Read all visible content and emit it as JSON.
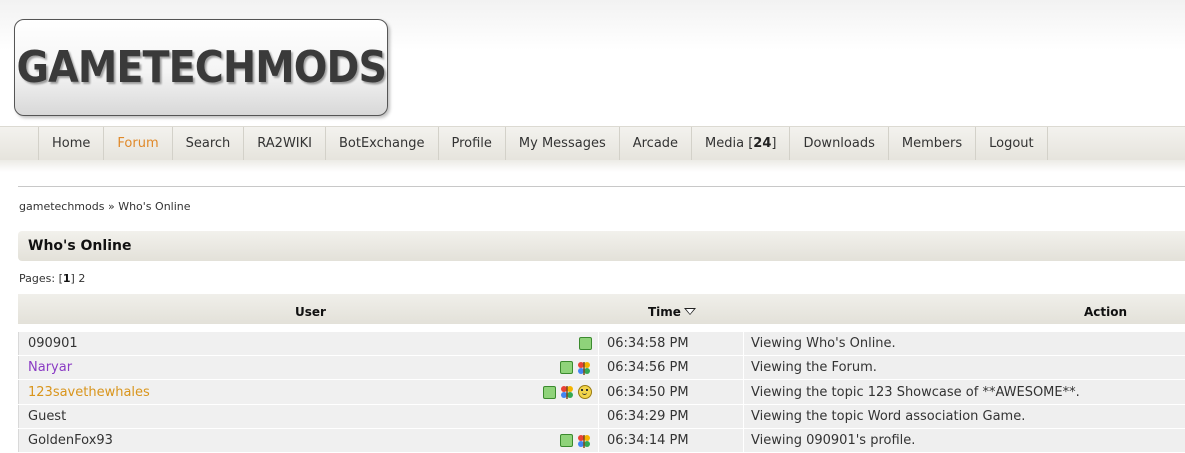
{
  "site": {
    "logo_text": "GAMETECHMODS"
  },
  "nav": {
    "items": [
      {
        "label": "Home"
      },
      {
        "label": "Forum"
      },
      {
        "label": "Search"
      },
      {
        "label": "RA2WIKI"
      },
      {
        "label": "BotExchange"
      },
      {
        "label": "Profile"
      },
      {
        "label": "My Messages"
      },
      {
        "label": "Arcade"
      },
      {
        "label": "Media [",
        "count": "24",
        "suffix": "]"
      },
      {
        "label": "Downloads"
      },
      {
        "label": "Members"
      },
      {
        "label": "Logout"
      }
    ],
    "active": "Forum",
    "active_color": "#e0892a"
  },
  "breadcrumb": {
    "home": "gametechmods",
    "separator": "»",
    "current": "Who's Online"
  },
  "page_title": "Who's Online",
  "pagination": {
    "label": "Pages:",
    "current": "1",
    "other": "2"
  },
  "table": {
    "headers": {
      "user": "User",
      "time": "Time",
      "action": "Action"
    },
    "sort_icon": "sort-descending-icon",
    "rows": [
      {
        "user": "090901",
        "user_color": "#333333",
        "icons": [
          "online-status-icon"
        ],
        "time": "06:34:58 PM",
        "action": "Viewing Who's Online."
      },
      {
        "user": "Naryar",
        "user_color": "#8a3bc4",
        "icons": [
          "online-status-icon",
          "msn-icon"
        ],
        "time": "06:34:56 PM",
        "action": "Viewing the Forum."
      },
      {
        "user": "123savethewhales",
        "user_color": "#d9951c",
        "icons": [
          "online-status-icon",
          "msn-icon",
          "smiley-icon"
        ],
        "time": "06:34:50 PM",
        "action": "Viewing the topic 123 Showcase of **AWESOME**."
      },
      {
        "user": "Guest",
        "user_color": "#333333",
        "icons": [],
        "time": "06:34:29 PM",
        "action": "Viewing the topic Word association Game."
      },
      {
        "user": "GoldenFox93",
        "user_color": "#333333",
        "icons": [
          "online-status-icon",
          "msn-icon"
        ],
        "time": "06:34:14 PM",
        "action": "Viewing 090901's profile."
      }
    ]
  }
}
